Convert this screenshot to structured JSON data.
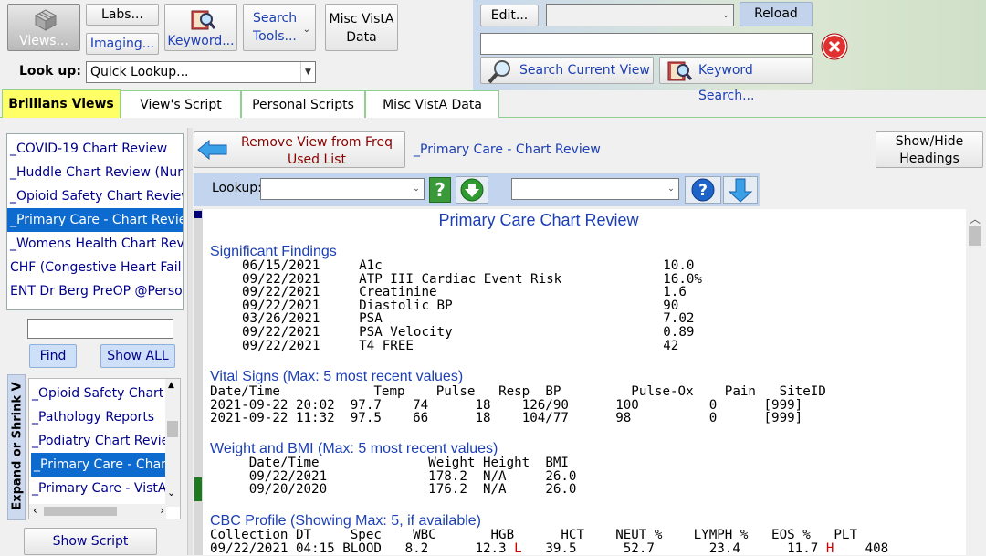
{
  "toolbar": {
    "views_label": "Views...",
    "labs_label": "Labs...",
    "imaging_label": "Imaging...",
    "keyword_label": "Keyword...",
    "search_tools_label": "Search Tools...",
    "misc_vista_label": "Misc VistA Data",
    "lookup_label": "Look up:",
    "lookup_value": "Quick Lookup..."
  },
  "right_toolbar": {
    "edit_label": "Edit...",
    "reload_label": "Reload",
    "search_current_view_label": "Search Current View",
    "keyword_search_label": "Keyword Search..."
  },
  "tabs": [
    {
      "label": "Brillians Views"
    },
    {
      "label": "View's Script"
    },
    {
      "label": "Personal Scripts"
    },
    {
      "label": "Misc VistA Data"
    }
  ],
  "views_list": [
    {
      "label": "_COVID-19 Chart Review"
    },
    {
      "label": "_Huddle Chart Review (Nursing)"
    },
    {
      "label": "_Opioid Safety Chart Review"
    },
    {
      "label": "_Primary Care - Chart Review"
    },
    {
      "label": "_Womens Health Chart Review"
    },
    {
      "label": "CHF (Congestive Heart Fail Chart)"
    },
    {
      "label": "ENT Dr Berg PreOP @Personal"
    }
  ],
  "sidebar": {
    "find_label": "Find",
    "show_all_label": "Show ALL",
    "expand_label": "Expand or Shrink V",
    "show_script_label": "Show Script"
  },
  "freq_list": [
    {
      "label": "_Opioid Safety Chart Review"
    },
    {
      "label": "_Pathology Reports"
    },
    {
      "label": "_Podiatry Chart Review"
    },
    {
      "label": "_Primary Care - Chart Review"
    },
    {
      "label": "_Primary Care - VistA"
    }
  ],
  "content_header": {
    "remove_view_label": "Remove View from Freq Used List",
    "view_title": "_Primary Care - Chart Review",
    "show_hide_label": "Show/Hide Headings",
    "lookup_label": "Lookup:"
  },
  "report": {
    "title": "Primary Care Chart Review",
    "significant_title": "Significant Findings",
    "significant_rows": [
      {
        "date": "06/15/2021",
        "name": "A1c",
        "value": "10.0"
      },
      {
        "date": "09/22/2021",
        "name": "ATP III Cardiac Event Risk",
        "value": "16.0%"
      },
      {
        "date": "09/22/2021",
        "name": "Creatinine",
        "value": "1.6"
      },
      {
        "date": "09/22/2021",
        "name": "Diastolic BP",
        "value": "90"
      },
      {
        "date": "03/26/2021",
        "name": "PSA",
        "value": "7.02"
      },
      {
        "date": "09/22/2021",
        "name": "PSA Velocity",
        "value": "0.89"
      },
      {
        "date": "09/22/2021",
        "name": "T4 FREE",
        "value": "42"
      }
    ],
    "vitals_title": "Vital Signs (Max: 5 most recent values)",
    "vitals_header": [
      "Date/Time",
      "Temp",
      "Pulse",
      "Resp",
      "BP",
      "Pulse-Ox",
      "Pain",
      "SiteID"
    ],
    "vitals_rows": [
      [
        "2021-09-22 20:02",
        "97.7",
        "74",
        "18",
        "126/90",
        "100",
        "0",
        "[999]"
      ],
      [
        "2021-09-22 11:32",
        "97.5",
        "66",
        "18",
        "104/77",
        "98",
        "0",
        "[999]"
      ]
    ],
    "weight_title": "Weight and BMI (Max: 5 most recent values)",
    "weight_header": [
      "Date/Time",
      "Weight",
      "Height",
      "BMI"
    ],
    "weight_rows": [
      [
        "09/22/2021",
        "178.2",
        "N/A",
        "26.0"
      ],
      [
        "09/20/2020",
        "176.2",
        "N/A",
        "26.0"
      ]
    ],
    "cbc_title": "CBC Profile (Showing Max: 5, if available)",
    "cbc_header": [
      "Collection DT",
      "Spec",
      "WBC",
      "HGB",
      "HCT",
      "NEUT %",
      "LYMPH %",
      "EOS %",
      "PLT"
    ],
    "cbc_rows": [
      {
        "dt": "09/22/2021 04:15",
        "spec": "BLOOD",
        "wbc": "8.2",
        "hgb": "12.3",
        "hgb_flag": "L",
        "hct": "39.5",
        "neut": "52.7",
        "lymph": "23.4",
        "eos": "11.7",
        "eos_flag": "H",
        "plt": "408"
      }
    ]
  }
}
